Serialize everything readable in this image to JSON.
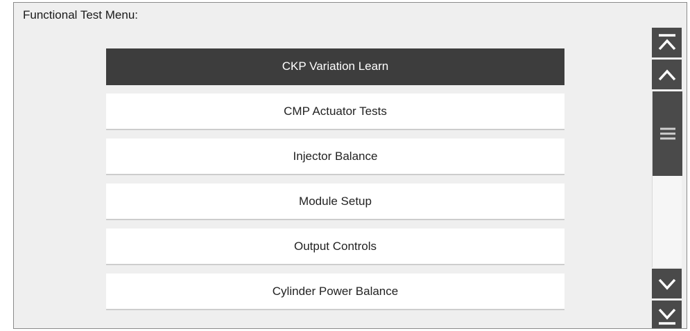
{
  "screen": {
    "title": "Functional Test Menu:"
  },
  "menu": {
    "items": [
      {
        "label": "CKP Variation Learn",
        "selected": true
      },
      {
        "label": "CMP Actuator Tests",
        "selected": false
      },
      {
        "label": "Injector Balance",
        "selected": false
      },
      {
        "label": "Module Setup",
        "selected": false
      },
      {
        "label": "Output Controls",
        "selected": false
      },
      {
        "label": "Cylinder Power Balance",
        "selected": false
      }
    ]
  },
  "scrollbar": {
    "buttons": [
      "scroll-to-top-icon",
      "scroll-up-icon",
      "scroll-down-icon",
      "scroll-to-bottom-icon"
    ],
    "thumb_icon": "drag-handle-icon"
  },
  "colors": {
    "selected_bg": "#3d3d3d",
    "scroll_control": "#4a4a4a",
    "panel_bg": "#efefef",
    "item_bg": "#ffffff"
  }
}
